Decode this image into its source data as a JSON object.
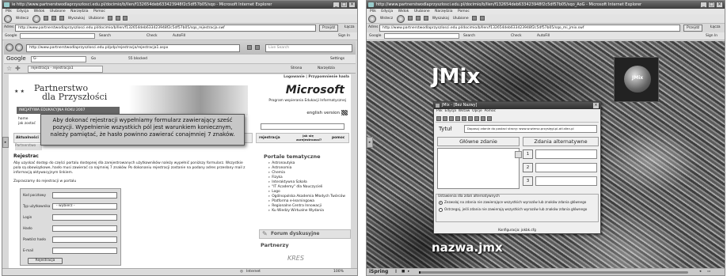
{
  "left": {
    "title": "ie http://www.partnerstwodlaprzyszlosci.edu.pl/docimio/b/llen/f132654deb633423948f2c5df57b05/sqo - Microsoft Internet Explorer",
    "outer_menu": [
      "Plik",
      "Edycja",
      "Widok",
      "Ulubione",
      "Narzędzia",
      "Pomoc"
    ],
    "outer_toolbar": {
      "back": "Wstecz",
      "search": "Wyszukaj",
      "favorites": "Ulubione"
    },
    "outer_address_label": "Adres",
    "outer_address": "http://www.partnerstwodlaprzyszlosci.edu.pl/docimio/b/llen/f132654deb633423948f2c5df57b05/sqo_rejestracja.swf",
    "outer_go": "Przejdź",
    "links_label": "Łącza",
    "google_label": "Google",
    "search_btn": "Search",
    "check_btn": "Check",
    "autofill_btn": "AutoFill",
    "signin": "Sign In",
    "inner_url": "http://www.partnerstwodlaprzyszlosci.edu.pl/pdp/rejestracja/rejestracja1.aspx",
    "live_search": "Live Search",
    "inner_google": "Google",
    "inner_google_input": "G-",
    "inner_go": "Go",
    "blocked": "55 blocked",
    "settings": "Settings",
    "tab_label": "rejestracja - rejestracja1",
    "page_menu": "Strona",
    "tools_menu": "Narzędzia",
    "login_links": "Logowanie | Przypomnienie hasła",
    "logo_line1": "Partnerstwo",
    "logo_line2": "dla Przyszłości",
    "logo_sub": "INICJATYWA EDUKACYJNA ROKU 2007",
    "ms_logo": "Microsoft",
    "ms_sub": "Program wspierania Edukacji Informatycznej",
    "english": "english version",
    "home_link": "home",
    "about_link": "jak zostać",
    "tab_active": "Aktualności",
    "tab_second": "Partnerstwo",
    "btn_register": "rejestracja",
    "btn_howto": "jak się zarejestrować?",
    "btn_help": "pomoc",
    "overlay_text": "Aby dokonać rejestracji wypełniamy formularz zawierający sześć pozycji. Wypełnienie wszystkich pól jest warunkiem koniecznym, należy pamiętać, że hasło powinno zawierać conajmniej 7 znaków.",
    "registration_heading": "Rejestrac",
    "registration_text": "Aby uzyskać dostęp do części portalu dostępnej dla zarejestrowanych użytkowników należy wypełnić poniższy formularz. Wszystkie pola są obowiązkowe, hasło musi zawierać co najmniej 7 znaków. Po dokonaniu rejestracji zostanie na podany adres przesłany mail z informacją aktywacyjnym linkiem.",
    "invite_text": "Zapraszamy do rejestracji w portalu",
    "form": [
      {
        "label": "Kod pocztowy",
        "value": ""
      },
      {
        "label": "Typ użytkownika",
        "value": "- wybierz -"
      },
      {
        "label": "Login",
        "value": ""
      },
      {
        "label": "Hasło",
        "value": ""
      },
      {
        "label": "Powtórz hasło",
        "value": ""
      },
      {
        "label": "E-mail",
        "value": ""
      }
    ],
    "submit": "Rejestracja",
    "portals_title": "Portale tematyczne",
    "portals": [
      "Astronautyka",
      "Astronomia",
      "Chemia",
      "Fizyka",
      "Interaktywna Szkoła",
      "\"IT Academy\" dla Nauczycieli",
      "Logo",
      "Ogólnopolska Akademia Młodych Twórców",
      "Platforma e-learningowa",
      "Regionalne Centra Innowacji",
      "Ku Wiedzy Wirtualne Wydania"
    ],
    "forum": "Forum dyskusyjne",
    "partners": "Partnerzy",
    "partner_logo": "KRES",
    "status_internet": "Internet",
    "status_zoom": "100%"
  },
  "right": {
    "title": "http://www.partnerstwodlaprzyszlosci.edu.pl/docimio/b/llen/f132654deb633423948f2c5df57b05/sqo_AoG - Microsoft Internet Explorer",
    "menu": [
      "Plik",
      "Edycja",
      "Widok",
      "Ulubione",
      "Narzędzia",
      "Pomoc"
    ],
    "back": "Wstecz",
    "search": "Wyszukaj",
    "favorites": "Ulubione",
    "address_label": "Adres",
    "address": "http://www.partnerstwodlaprzyszlosci.edu.pl/docimio/b/llen/f132654deb633423948f2c5df57b05/sqo_mi_jmix.swf",
    "go": "Przejdź",
    "links": "Łącza",
    "google_label": "Google",
    "search_btn": "Search",
    "check_btn": "Check",
    "autofill_btn": "AutoFill",
    "signin": "Sign In",
    "heading": "JMix",
    "caption": "nazwa.jmx",
    "thumb_label": "JMix",
    "app_title": "JMix - [Bez Nazwy]",
    "app_menu": [
      "Plik",
      "Edycja",
      "Wstaw",
      "Opcje",
      "Pomoc"
    ],
    "tytul_label": "Tytuł",
    "tytul_value": "Dopasuj zdanie do postaci strony: www.w.wiersz.przysięgi.pl-atl.sfan.pl",
    "col_main": "Główne zdanie",
    "col_alt": "Zdania alternatywne",
    "alt_nums": [
      "1",
      "2",
      "3"
    ],
    "settings_label": "Ustawienia dla zdań alternatywnych",
    "radio1": "Zezwalaj na zdania nie zawierające wszystkich wyrazów lub znaków zdania głównego",
    "radio2": "Ostrzegaj, jeśli zdania nie zawierają wszystkich wyrazów lub znaków zdania głównego",
    "config": "Konfiguracja: jokbk.cfg",
    "player_brand": "iSpring"
  },
  "colors": {
    "accent": "#3c3c3c",
    "titlebar": "#4a4a4a",
    "overlay": "#c7c7c7"
  }
}
